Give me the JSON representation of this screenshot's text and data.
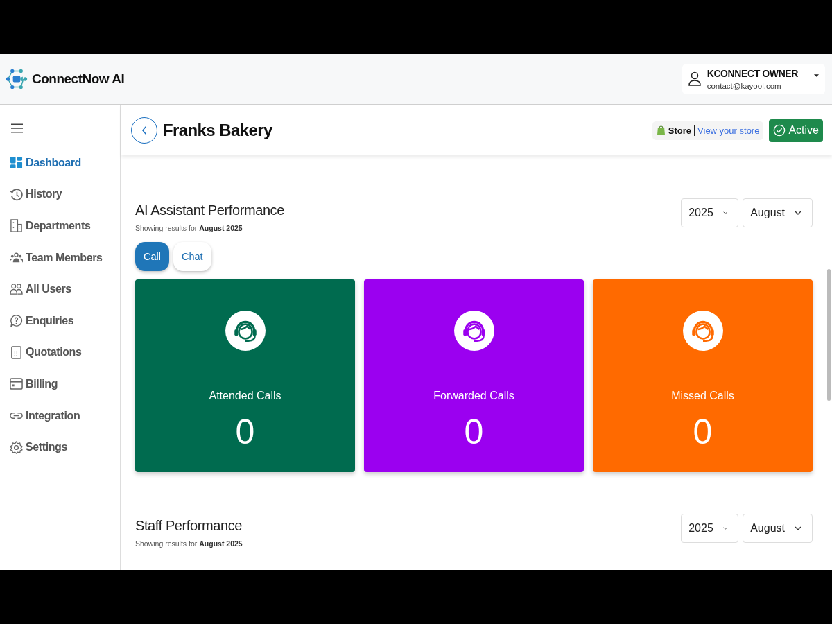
{
  "app": {
    "name": "ConnectNow AI"
  },
  "user": {
    "name": "KCONNECT OWNER",
    "email": "contact@kayool.com"
  },
  "sidebar": {
    "items": [
      {
        "label": "Dashboard",
        "selected": true
      },
      {
        "label": "History",
        "selected": false
      },
      {
        "label": "Departments",
        "selected": false
      },
      {
        "label": "Team Members",
        "selected": false
      },
      {
        "label": "All Users",
        "selected": false
      },
      {
        "label": "Enquiries",
        "selected": false
      },
      {
        "label": "Quotations",
        "selected": false
      },
      {
        "label": "Billing",
        "selected": false
      },
      {
        "label": "Integration",
        "selected": false
      },
      {
        "label": "Settings",
        "selected": false
      }
    ]
  },
  "page_header": {
    "title": "Franks Bakery",
    "store_label": "Store",
    "store_link": "View your store",
    "status": "Active"
  },
  "sections": [
    {
      "title": "AI Assistant Performance",
      "subtitle": "Showing results for **August 2025**",
      "year": "2025",
      "month": "August",
      "tabs": [
        {
          "label": "Call",
          "selected": true
        },
        {
          "label": "Chat",
          "selected": false
        }
      ],
      "cards": [
        {
          "label": "Attended Calls",
          "value": "0",
          "color": "#006b4f"
        },
        {
          "label": "Forwarded Calls",
          "value": "0",
          "color": "#9b00f0"
        },
        {
          "label": "Missed Calls",
          "value": "0",
          "color": "#ff6a00"
        }
      ]
    },
    {
      "title": "Staff Performance",
      "subtitle": "Showing results for **August 2025**",
      "year": "2025",
      "month": "August"
    }
  ]
}
